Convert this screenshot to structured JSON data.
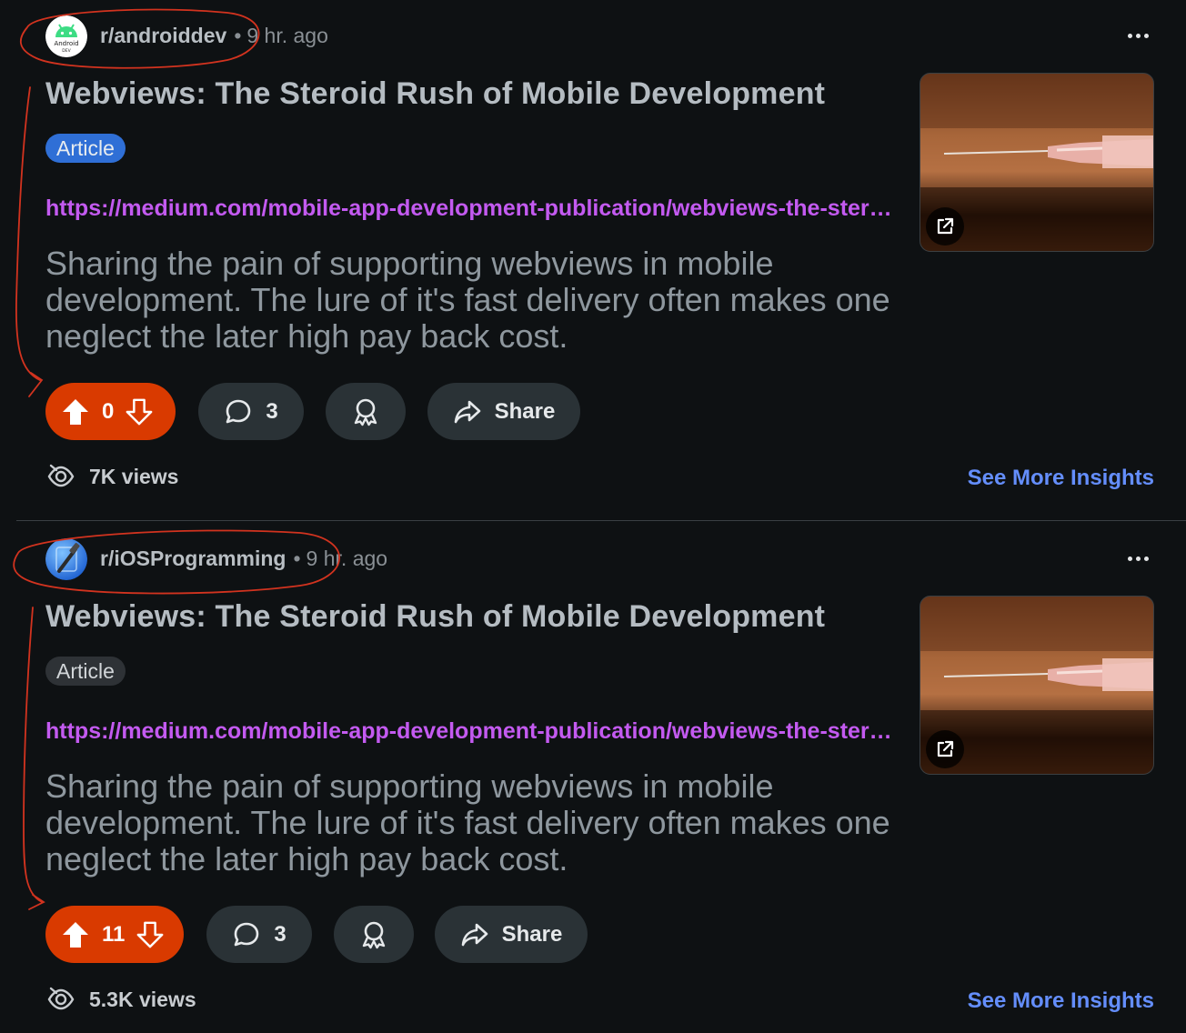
{
  "colors": {
    "background": "#0e1113",
    "upvote_active": "#d93a00",
    "link": "#c35af0",
    "insights": "#648efc",
    "flair_blue": "#2f6fd6",
    "annotation_red": "#d2331f"
  },
  "posts": [
    {
      "subreddit": "r/androiddev",
      "separator": "•",
      "time": "9 hr. ago",
      "avatar_text": "Android",
      "avatar_subtext": "DEV",
      "title": "Webviews: The Steroid Rush of Mobile Development",
      "flair": "Article",
      "link": "https://medium.com/mobile-app-development-publication/webviews-the-steroid-rush-of-mobile-development",
      "body": "Sharing the pain of supporting webviews in mobile development. The lure of it's fast delivery often makes one neglect the later high pay back cost.",
      "votes": "0",
      "comments": "3",
      "share_label": "Share",
      "views": "7K views",
      "insights_label": "See More Insights",
      "icons": [
        "upvote-icon",
        "downvote-icon",
        "comment-icon",
        "award-icon",
        "share-icon",
        "views-icon",
        "external-link-icon",
        "more-icon"
      ]
    },
    {
      "subreddit": "r/iOSProgramming",
      "separator": "•",
      "time": "9 hr. ago",
      "title": "Webviews: The Steroid Rush of Mobile Development",
      "flair": "Article",
      "link": "https://medium.com/mobile-app-development-publication/webviews-the-steroid-rush-of-mobile-development",
      "body": "Sharing the pain of supporting webviews in mobile development. The lure of it's fast delivery often makes one neglect the later high pay back cost.",
      "votes": "11",
      "comments": "3",
      "share_label": "Share",
      "views": "5.3K views",
      "insights_label": "See More Insights",
      "icons": [
        "upvote-icon",
        "downvote-icon",
        "comment-icon",
        "award-icon",
        "share-icon",
        "views-icon",
        "external-link-icon",
        "more-icon"
      ]
    }
  ]
}
